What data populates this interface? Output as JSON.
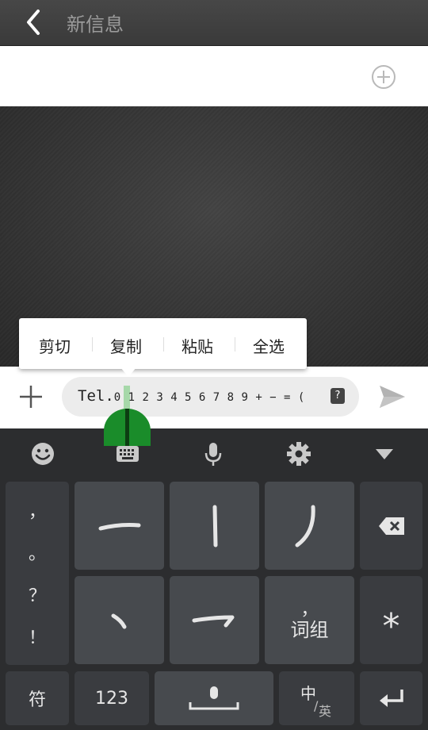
{
  "header": {
    "title": "新信息",
    "back_icon": "chevron-left-icon"
  },
  "recipient": {
    "add_icon": "plus-circle-icon"
  },
  "context_menu": {
    "items": [
      "剪切",
      "复制",
      "粘贴",
      "全选"
    ]
  },
  "compose": {
    "input_prefix": "Tel.",
    "input_value": "0 1 2 3 4 5 6 7 8 9 + − = (",
    "help_label": "?",
    "attach_icon": "plus-icon",
    "send_icon": "send-icon"
  },
  "keyboard_toolbar": {
    "icons": [
      "emoji-icon",
      "keyboard-icon",
      "microphone-icon",
      "settings-icon",
      "collapse-keyboard-icon"
    ]
  },
  "keyboard": {
    "punct_column": [
      "，",
      "。",
      "？",
      "！"
    ],
    "strokes": [
      "一",
      "丨",
      "丿",
      "丶",
      "乛"
    ],
    "word_key_comma": "，",
    "word_key_label": "词组",
    "star_label": "*",
    "symbol_label": "符",
    "number_label": "123",
    "lang_main": "中",
    "lang_slash": "/",
    "lang_alt": "英",
    "delete_icon": "backspace-icon",
    "space_icon": "space-mic-icon",
    "enter_icon": "enter-icon"
  },
  "colors": {
    "accent_green": "#1a8c2a",
    "keyboard_bg": "#2c2d2f",
    "key_bg": "#474a4e"
  }
}
